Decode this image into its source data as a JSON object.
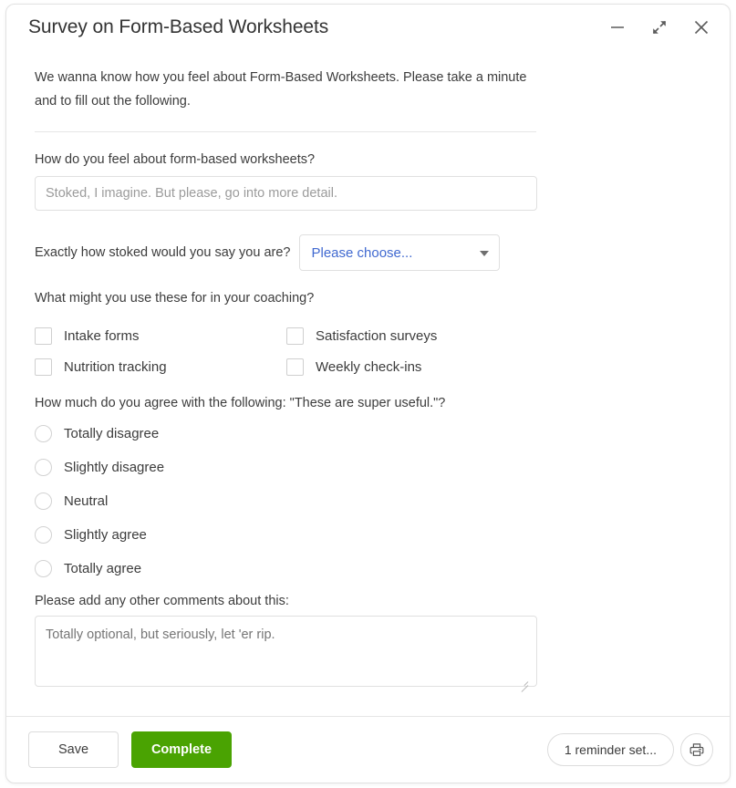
{
  "window": {
    "title": "Survey on Form-Based Worksheets",
    "controls": [
      {
        "name": "minimize-button",
        "icon": "minimize-icon"
      },
      {
        "name": "collapse-button",
        "icon": "collapse-arrows-icon"
      },
      {
        "name": "close-button",
        "icon": "close-icon"
      }
    ]
  },
  "intro": "We wanna know how you feel about Form-Based Worksheets. Please take a minute and to fill out the following.",
  "questions": {
    "free_text": {
      "label": "How do you feel about form-based worksheets?",
      "value": "",
      "placeholder": "Stoked, I imagine. But please, go into more detail."
    },
    "dropdown": {
      "label": "Exactly how stoked would you say you are?",
      "selected": "Please choose...",
      "caret_icon": "chevron-down-icon"
    },
    "checkboxes": {
      "label": "What might you use these for in your coaching?",
      "options": [
        "Intake forms",
        "Satisfaction surveys",
        "Nutrition tracking",
        "Weekly check-ins"
      ]
    },
    "radios": {
      "label": "How much do you agree with the following: \"These are super useful.\"?",
      "options": [
        "Totally disagree",
        "Slightly disagree",
        "Neutral",
        "Slightly agree",
        "Totally agree"
      ]
    },
    "comments": {
      "label": "Please add any other comments about this:",
      "value": "",
      "placeholder": "Totally optional, but seriously, let 'er rip."
    }
  },
  "footer": {
    "save_label": "Save",
    "complete_label": "Complete",
    "reminder_label": "1 reminder set...",
    "print_icon": "printer-icon"
  },
  "colors": {
    "accent_green": "#4aa302",
    "link_blue": "#4069d0",
    "text": "#3c3c3c",
    "placeholder": "#9b9b9b",
    "border": "#e0e0e0"
  }
}
